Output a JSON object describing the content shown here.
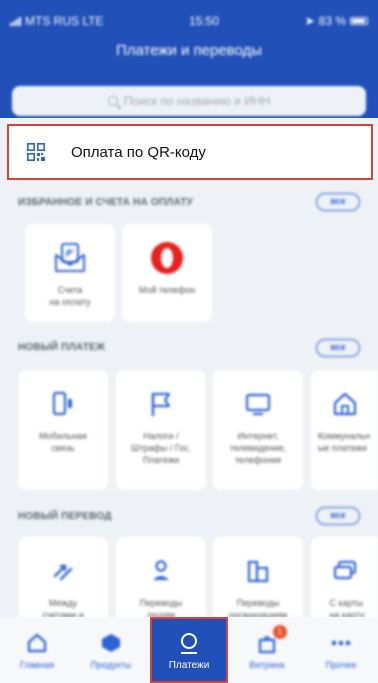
{
  "status_bar": {
    "carrier": "MTS RUS  LTE",
    "time": "15:50",
    "battery": "83 %"
  },
  "header": {
    "title": "Платежи и переводы"
  },
  "search": {
    "placeholder": "Поиск по названию и ИНН"
  },
  "qr": {
    "label": "Оплата по QR-коду",
    "icon": "qr-icon"
  },
  "sections": {
    "favorites": {
      "title": "ИЗБРАННОЕ И СЧЕТА НА ОПЛАТУ",
      "all": "все",
      "items": [
        {
          "label": "Счета\nна оплату",
          "icon": "invoice-envelope-icon"
        },
        {
          "label": "Мой телефон",
          "icon": "operator-logo-icon"
        }
      ]
    },
    "new_payment": {
      "title": "НОВЫЙ ПЛАТЕЖ",
      "all": "все",
      "items": [
        {
          "label": "Мобильная\nсвязь",
          "icon": "mobile-phone-icon"
        },
        {
          "label": "Налоги /\nШтрафы / Гос.\nПлатежи",
          "icon": "flag-icon"
        },
        {
          "label": "Интернет,\nтелевидение,\nтелефония",
          "icon": "tv-icon"
        },
        {
          "label": "Коммунальн\nые платежи",
          "icon": "home-icon"
        }
      ]
    },
    "new_transfer": {
      "title": "НОВЫЙ ПЕРЕВОД",
      "all": "все",
      "items": [
        {
          "label": "Между\nсчетами и",
          "icon": "arrows-icon"
        },
        {
          "label": "Переводы\nлюдям",
          "icon": "person-icon"
        },
        {
          "label": "Переводы\nорганизациям",
          "icon": "buildings-icon"
        },
        {
          "label": "С карты\nна карту",
          "icon": "cards-icon"
        }
      ]
    }
  },
  "tabbar": {
    "tabs": [
      {
        "label": "Главная",
        "icon": "home-tab-icon"
      },
      {
        "label": "Продукты",
        "icon": "products-icon"
      },
      {
        "label": "Платежи",
        "icon": "payments-icon",
        "active": true
      },
      {
        "label": "Витрина",
        "icon": "showcase-icon",
        "badge": "1"
      },
      {
        "label": "Прочее",
        "icon": "more-icon"
      }
    ]
  },
  "colors": {
    "brand": "#2150b8",
    "accent": "#2d63d4",
    "highlight": "#d9423a"
  }
}
